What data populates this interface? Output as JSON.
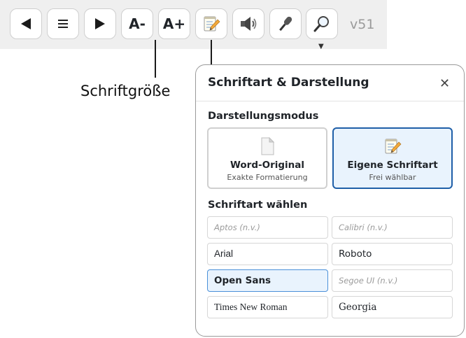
{
  "toolbar": {
    "buttons": [
      {
        "name": "prev-page-button",
        "icon": "left-triangle-icon"
      },
      {
        "name": "menu-button",
        "icon": "hamburger-menu-icon"
      },
      {
        "name": "next-page-button",
        "icon": "right-triangle-icon"
      },
      {
        "name": "font-decrease-button",
        "label": "A-"
      },
      {
        "name": "font-increase-button",
        "label": "A+"
      },
      {
        "name": "font-settings-button",
        "icon": "memo-pencil-icon"
      },
      {
        "name": "speaker-button",
        "icon": "speaker-icon"
      },
      {
        "name": "microphone-button",
        "icon": "microphone-icon"
      },
      {
        "name": "search-button",
        "icon": "magnifier-icon"
      }
    ],
    "version": "v51",
    "dropdown_caret": "▼"
  },
  "callout": {
    "label": "Schriftgröße"
  },
  "panel": {
    "title": "Schriftart & Darstellung",
    "close": "✕",
    "mode_section_label": "Darstellungsmodus",
    "modes": [
      {
        "title": "Word-Original",
        "subtitle": "Exakte Formatierung",
        "icon": "document-icon",
        "active": false
      },
      {
        "title": "Eigene Schriftart",
        "subtitle": "Frei wählbar",
        "icon": "memo-pencil-icon",
        "active": true
      }
    ],
    "font_section_label": "Schriftart wählen",
    "fonts": [
      {
        "label": "Aptos (n.v.)",
        "available": false,
        "selected": false
      },
      {
        "label": "Calibri (n.v.)",
        "available": false,
        "selected": false
      },
      {
        "label": "Arial",
        "available": true,
        "selected": false
      },
      {
        "label": "Roboto",
        "available": true,
        "selected": false
      },
      {
        "label": "Open Sans",
        "available": true,
        "selected": true
      },
      {
        "label": "Segoe UI (n.v.)",
        "available": false,
        "selected": false
      },
      {
        "label": "Times New Roman",
        "available": true,
        "selected": false
      },
      {
        "label": "Georgia",
        "available": true,
        "selected": false
      }
    ]
  },
  "colors": {
    "toolbar_bg": "#efefef",
    "accent": "#1f5fa8",
    "selected_bg": "#e9f3fd",
    "panel_border": "#9a9a9a"
  }
}
